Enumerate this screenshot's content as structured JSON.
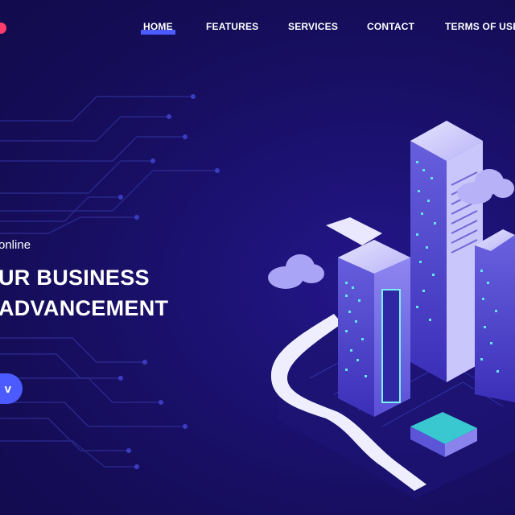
{
  "nav": {
    "items": [
      {
        "label": "HOME",
        "active": true
      },
      {
        "label": "FEATURES",
        "active": false
      },
      {
        "label": "SERVICES",
        "active": false
      },
      {
        "label": "CONTACT",
        "active": false
      },
      {
        "label": "TERMS OF USE",
        "active": false
      }
    ]
  },
  "hero": {
    "tagline": "online",
    "headline_line1": "UR BUSINESS",
    "headline_line2": "ADVANCEMENT",
    "cta_label": "v"
  },
  "colors": {
    "background": "#170f5e",
    "accent": "#4b5bff",
    "logo": "#ff3b6b",
    "glow": "#3ee8e0"
  },
  "illustration": {
    "name": "isometric-server-city"
  }
}
